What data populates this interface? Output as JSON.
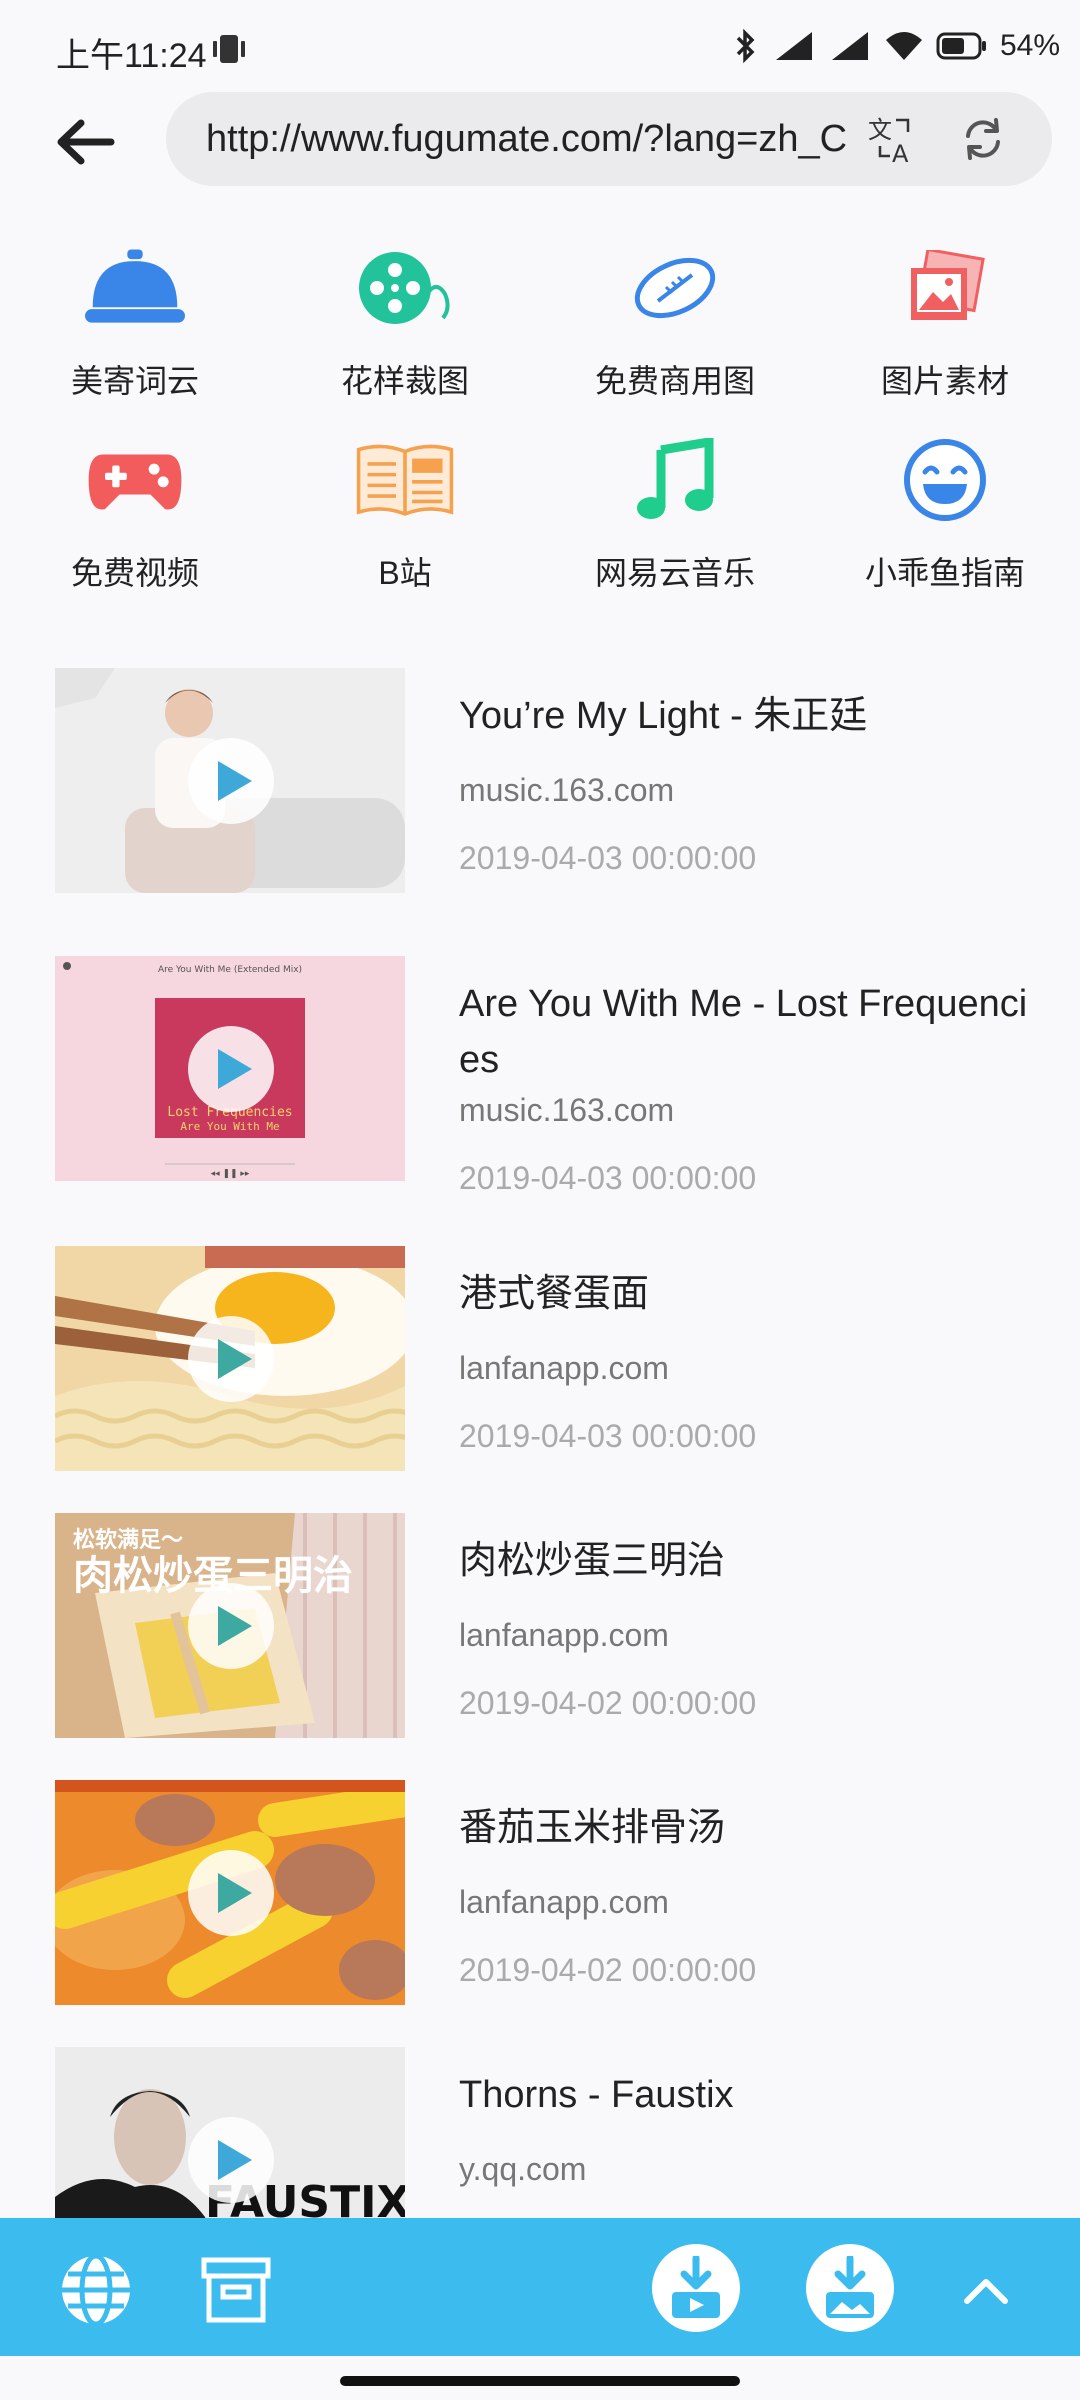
{
  "status": {
    "time": "上午11:24",
    "battery": "54%"
  },
  "browser": {
    "url": "http://www.fugumate.com/?lang=zh_CN"
  },
  "shortcuts": [
    {
      "label": "美寄词云"
    },
    {
      "label": "花样裁图"
    },
    {
      "label": "免费商用图"
    },
    {
      "label": "图片素材"
    },
    {
      "label": "免费视频"
    },
    {
      "label": "B站"
    },
    {
      "label": "网易云音乐"
    },
    {
      "label": "小乖鱼指南"
    }
  ],
  "items": [
    {
      "title": "You’re My Light - 朱正廷",
      "source": "music.163.com",
      "date": "2019-04-03 00:00:00"
    },
    {
      "title": "Are You With Me - Lost Frequencies",
      "source": "music.163.com",
      "date": "2019-04-03 00:00:00",
      "thumb_text": {
        "header": "Are You With Me (Extended Mix)",
        "line1": "Lost Frequencies",
        "line2": "Are You With Me"
      }
    },
    {
      "title": "港式餐蛋面",
      "source": "lanfanapp.com",
      "date": "2019-04-03 00:00:00"
    },
    {
      "title": "肉松炒蛋三明治",
      "source": "lanfanapp.com",
      "date": "2019-04-02 00:00:00",
      "thumb_text": {
        "small": "松软满足～",
        "big": "肉松炒蛋三明治"
      }
    },
    {
      "title": "番茄玉米排骨汤",
      "source": "lanfanapp.com",
      "date": "2019-04-02 00:00:00"
    },
    {
      "title": "Thorns - Faustix",
      "source": "y.qq.com",
      "date": "",
      "thumb_text": {
        "logo": "FAUSTIX"
      }
    }
  ],
  "colors": {
    "toolbar": "#3cbcee",
    "background": "#f9f9fb"
  }
}
